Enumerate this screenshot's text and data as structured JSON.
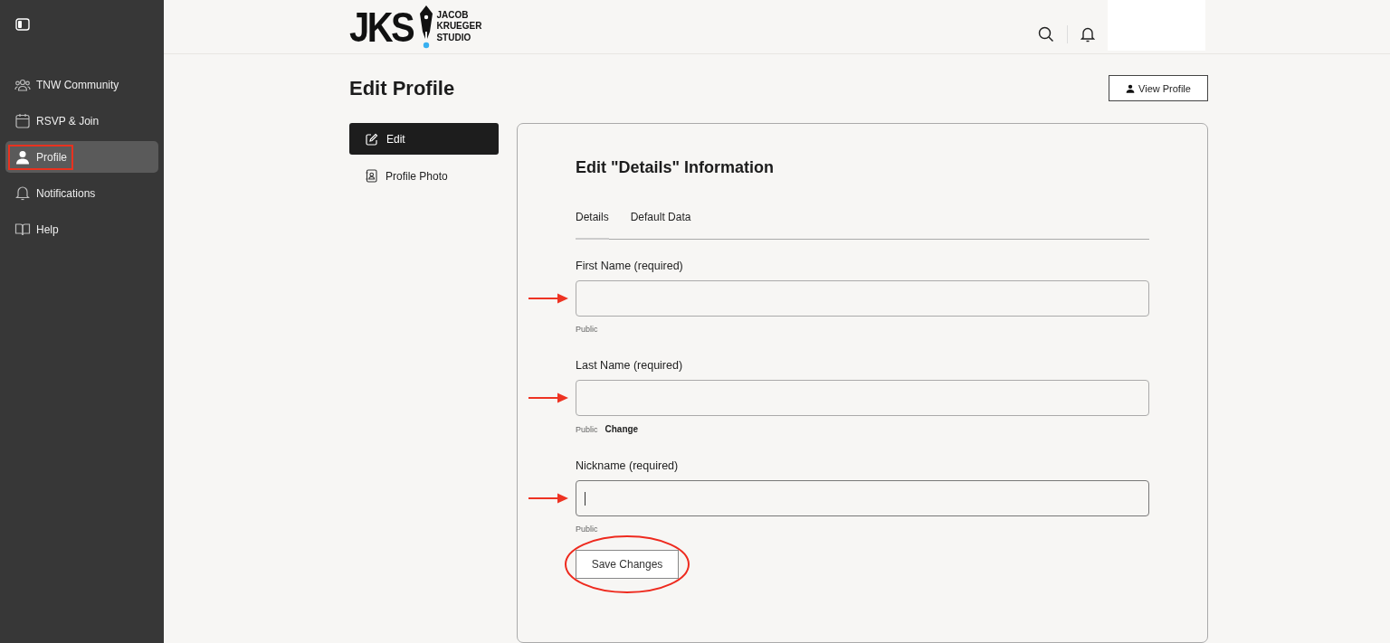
{
  "sidebar": {
    "items": [
      {
        "label": "TNW Community",
        "selected": false,
        "highlighted": false
      },
      {
        "label": "RSVP & Join",
        "selected": false,
        "highlighted": false
      },
      {
        "label": "Profile",
        "selected": true,
        "highlighted": true
      },
      {
        "label": "Notifications",
        "selected": false,
        "highlighted": false
      },
      {
        "label": "Help",
        "selected": false,
        "highlighted": false
      }
    ]
  },
  "header": {
    "logo": {
      "mark": "JKS",
      "name_lines": [
        "JACOB",
        "KRUEGER",
        "STUDIO"
      ]
    }
  },
  "page": {
    "title": "Edit Profile",
    "view_button": "View Profile"
  },
  "subnav": [
    {
      "label": "Edit",
      "selected": true
    },
    {
      "label": "Profile Photo",
      "selected": false
    }
  ],
  "panel": {
    "heading": "Edit \"Details\" Information",
    "tabs": [
      {
        "label": "Details",
        "selected": true
      },
      {
        "label": "Default Data",
        "selected": false
      }
    ],
    "fields": [
      {
        "label": "First Name (required)",
        "hint": "Public",
        "focused": false,
        "annotated": true
      },
      {
        "label": "Last Name (required)",
        "hint": "Public",
        "link": "Change",
        "focused": false,
        "annotated": true
      },
      {
        "label": "Nickname (required)",
        "hint": "Public",
        "focused": true,
        "annotated": true
      }
    ],
    "save_button": {
      "label": "Save Changes",
      "circled": true
    }
  }
}
